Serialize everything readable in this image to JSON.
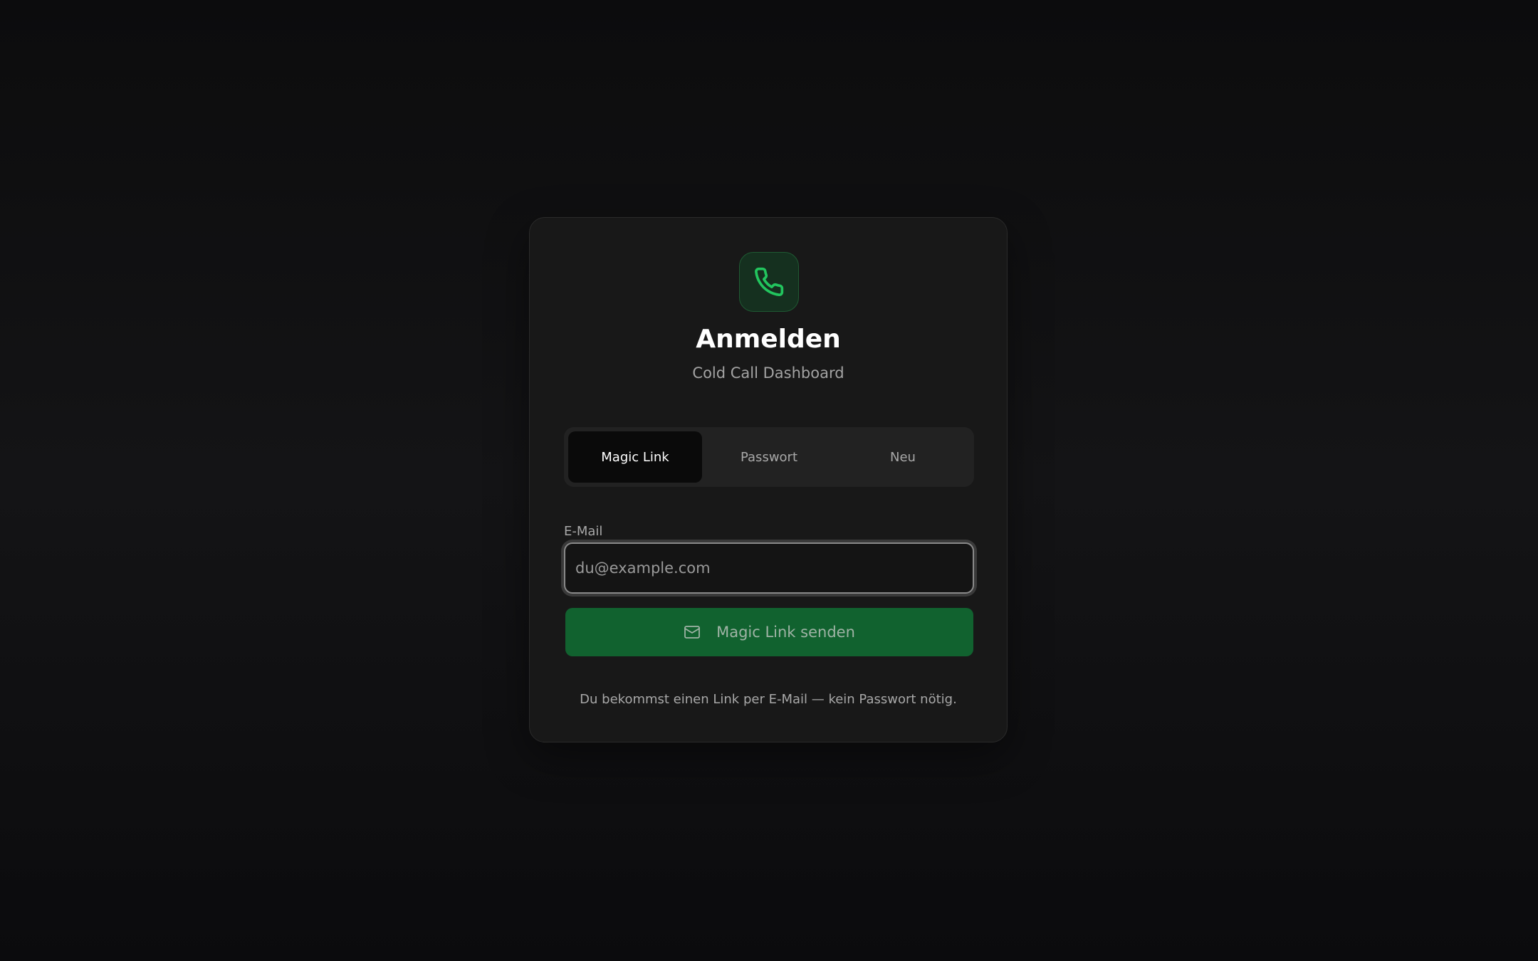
{
  "login": {
    "logo_icon": "phone-icon",
    "title": "Anmelden",
    "subtitle": "Cold Call Dashboard",
    "tabs": [
      {
        "label": "Magic Link",
        "active": true
      },
      {
        "label": "Passwort",
        "active": false
      },
      {
        "label": "Neu",
        "active": false
      }
    ],
    "email": {
      "label": "E-Mail",
      "value": "",
      "placeholder": "du@example.com"
    },
    "submit": {
      "icon": "mail-icon",
      "label": "Magic Link senden"
    },
    "hint": "Du bekommst einen Link per E-Mail — kein Passwort nötig."
  },
  "colors": {
    "accent": "#22c55e",
    "button": "#11622f",
    "background": "#0f0f10",
    "card": "#181818"
  }
}
